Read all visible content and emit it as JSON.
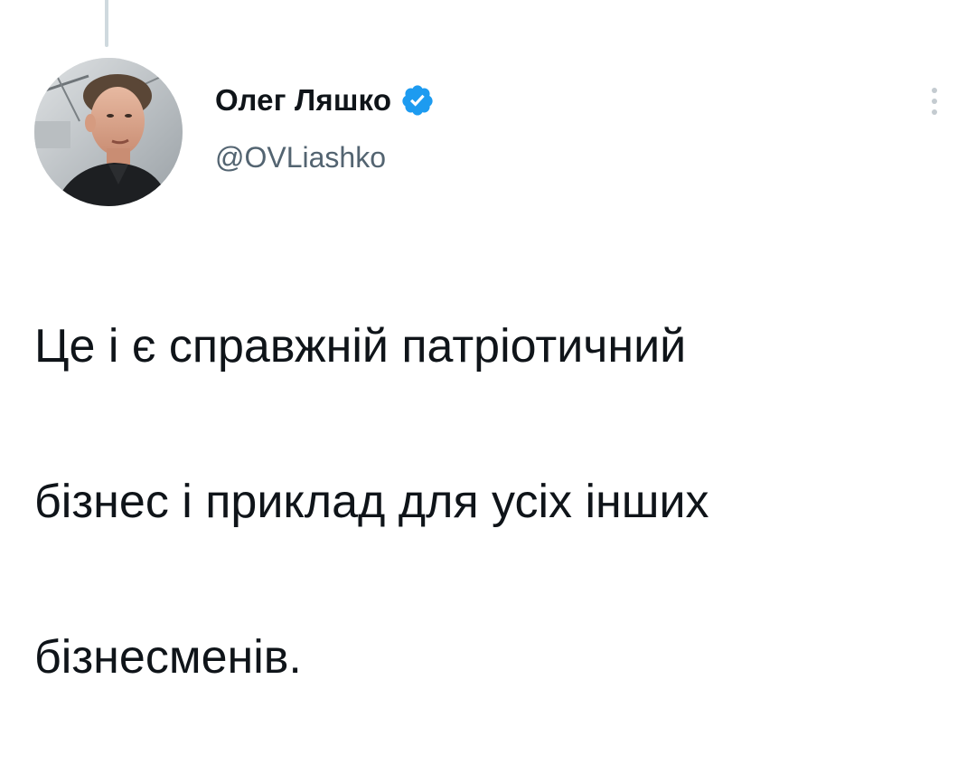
{
  "tweet": {
    "author": {
      "display_name": "Олег Ляшко",
      "handle": "@OVLiashko",
      "verified": true,
      "avatar_icon": "avatar-photo"
    },
    "text_lines": [
      "Це і є справжній патріотичний",
      "бізнес і приклад для усіх інших",
      "бізнесменів."
    ],
    "more_icon": "more-vertical-icon"
  },
  "colors": {
    "text_primary": "#0f1419",
    "text_secondary": "#536471",
    "verified_blue": "#1d9bf0",
    "thread_line": "#cfd9de"
  }
}
